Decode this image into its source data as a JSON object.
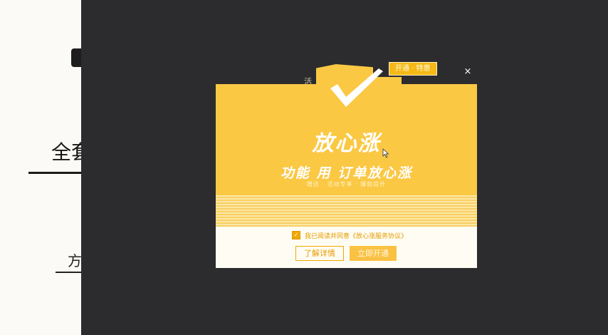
{
  "background": {
    "left_title": "全套",
    "left_subtitle": "方"
  },
  "dialog": {
    "brand_title": "放心涨",
    "slogan": "功能 用 订单放心涨",
    "sub_slogan": "赠送 · 活动专享 · 爆款提升",
    "promo_tag": "开通 · 特惠",
    "close_symbol": "×",
    "agreement_text": "我已阅读并同意《放心涨服务协议》",
    "agree_checked": true,
    "learn_more_label": "了解详情",
    "enable_label": "立即开通",
    "edge_text": "活"
  },
  "colors": {
    "brand_yellow": "#fbc844",
    "accent_orange": "#f0a800",
    "overlay": "#2c2c2f"
  },
  "icons": {
    "check": "check-icon",
    "close": "close-icon",
    "cursor": "cursor-icon"
  }
}
